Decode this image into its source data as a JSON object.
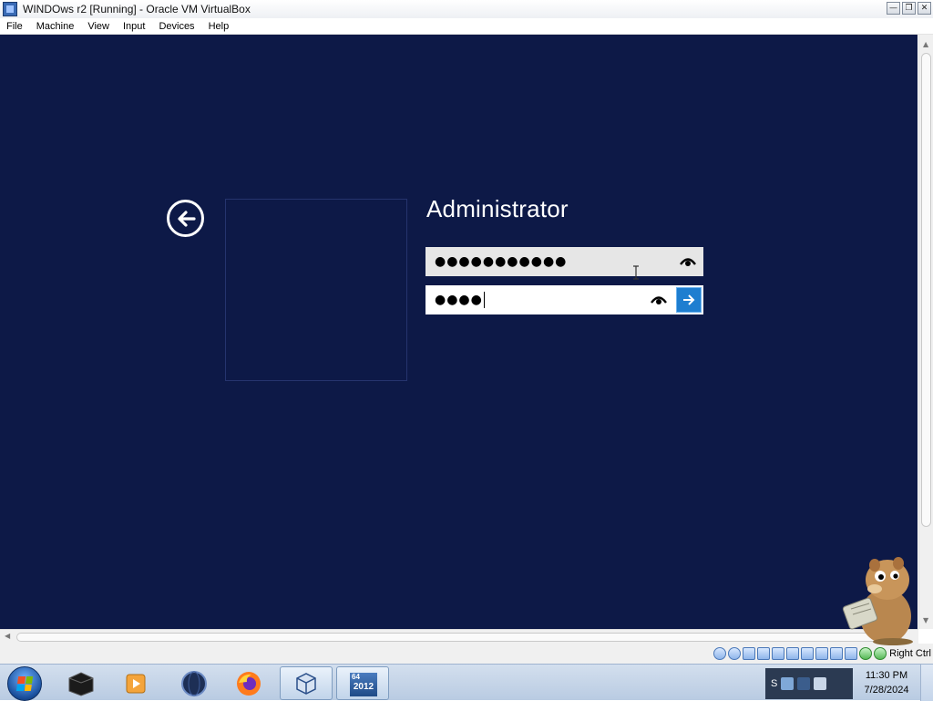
{
  "window": {
    "title": "WINDOws r2 [Running] - Oracle VM VirtualBox",
    "controls": [
      "minimize",
      "restore",
      "close"
    ]
  },
  "menu": [
    "File",
    "Machine",
    "View",
    "Input",
    "Devices",
    "Help"
  ],
  "login": {
    "username": "Administrator",
    "password_field_1_value": "●●●●●●●●●●●",
    "password_field_2_value": "●●●●",
    "icons": {
      "back": "back-arrow-icon",
      "reveal": "eye-icon",
      "submit": "arrow-right-icon"
    },
    "colors": {
      "background": "#0d1947",
      "submit_button": "#1e7ed0"
    }
  },
  "statusbar": {
    "host_key": "Right Ctrl"
  },
  "taskbar": {
    "apps": [
      {
        "name": "terminal-app",
        "label": ""
      },
      {
        "name": "media-player-app",
        "label": ""
      },
      {
        "name": "browser-sphere-app",
        "label": ""
      },
      {
        "name": "firefox-app",
        "label": ""
      },
      {
        "name": "virtualbox-app",
        "label": ""
      },
      {
        "name": "windows-server-2012-app",
        "badge_top": "64",
        "badge_main": "2012"
      }
    ],
    "tray_text": "S",
    "clock": {
      "time": "11:30 PM",
      "date": "7/28/2024"
    }
  }
}
